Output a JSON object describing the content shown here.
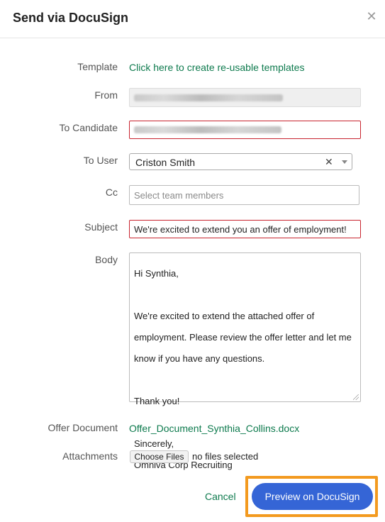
{
  "dialog": {
    "title": "Send via DocuSign",
    "close_icon": "close-icon"
  },
  "labels": {
    "template": "Template",
    "from": "From",
    "to_candidate": "To Candidate",
    "to_user": "To User",
    "cc": "Cc",
    "subject": "Subject",
    "body": "Body",
    "offer_document": "Offer Document",
    "attachments": "Attachments"
  },
  "template_link": "Click here to create re-usable templates",
  "to_user": {
    "value": "Criston Smith",
    "clear_symbol": "✕"
  },
  "cc": {
    "placeholder": "Select team members"
  },
  "subject": {
    "value": "We're excited to extend you an offer of employment!"
  },
  "body": {
    "lines": [
      "Hi Synthia,",
      "",
      "We're excited to extend the attached offer of",
      "employment. Please review the offer letter and let me",
      "know if you have any questions.",
      "",
      "Thank you!",
      "",
      "Sincerely,",
      "Omniva Corp Recruiting"
    ]
  },
  "offer_document": "Offer_Document_Synthia_Collins.docx",
  "attachments": {
    "button_label": "Choose Files",
    "status": "no files selected"
  },
  "footer": {
    "cancel_label": "Cancel",
    "primary_label": "Preview on DocuSign"
  },
  "colors": {
    "accent": "#3565d6",
    "link": "#0d7a4d",
    "error": "#c8242f",
    "highlight": "#f39a1f"
  }
}
